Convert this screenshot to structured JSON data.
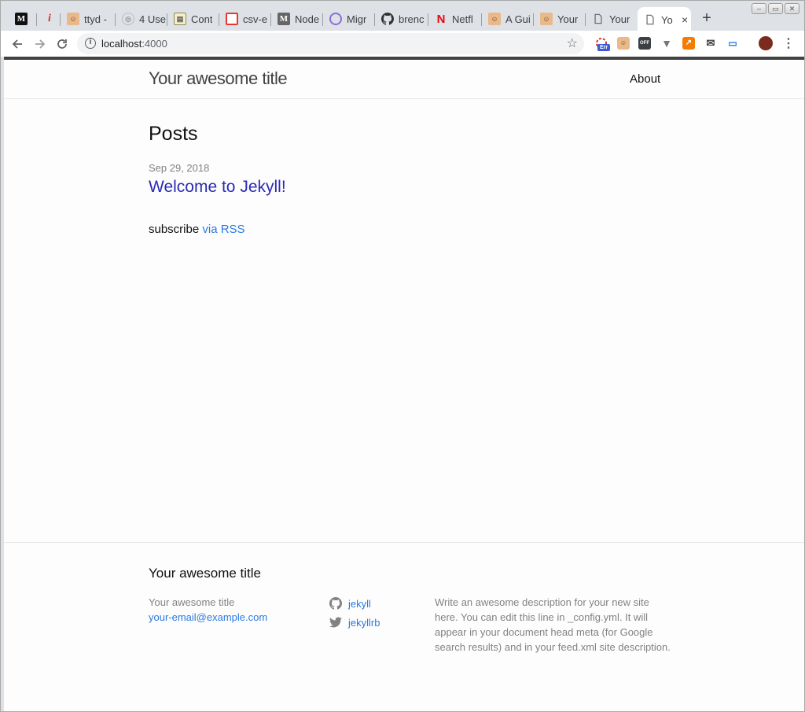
{
  "browser": {
    "tabs": [
      {
        "title": "",
        "icon": "medium-icon"
      },
      {
        "title": "",
        "icon": "red-i-icon"
      },
      {
        "title": "ttyd -",
        "icon": "face-icon"
      },
      {
        "title": "4 Use",
        "icon": "globe-icon"
      },
      {
        "title": "Cont",
        "icon": "doc-icon"
      },
      {
        "title": "csv-e",
        "icon": "red-box-icon"
      },
      {
        "title": "Node",
        "icon": "medium-icon"
      },
      {
        "title": "Migr",
        "icon": "purple-circle-icon"
      },
      {
        "title": "brenc",
        "icon": "github-icon"
      },
      {
        "title": "Netfl",
        "icon": "netflix-icon"
      },
      {
        "title": "A Gui",
        "icon": "face-icon"
      },
      {
        "title": "Your",
        "icon": "face-icon"
      },
      {
        "title": "Your",
        "icon": "page-icon"
      },
      {
        "title": "Yo",
        "icon": "page-icon",
        "active": true
      }
    ],
    "new_tab": "+",
    "close": "×",
    "url_host": "localhost",
    "url_port": ":4000",
    "ext_err_label": "Err",
    "ext_off_label": "OFF"
  },
  "header": {
    "site_title": "Your awesome title",
    "nav_about": "About"
  },
  "main": {
    "heading": "Posts",
    "posts": [
      {
        "date": "Sep 29, 2018",
        "title": "Welcome to Jekyll!"
      }
    ],
    "rss_prefix": "subscribe",
    "rss_link": "via RSS"
  },
  "footer": {
    "heading": "Your awesome title",
    "name": "Your awesome title",
    "email": "your-email@example.com",
    "github": "jekyll",
    "twitter": "jekyllrb",
    "description": "Write an awesome description for your new site here. You can edit this line in _config.yml. It will appear in your document head meta (for Google search results) and in your feed.xml site description."
  },
  "colors": {
    "link": "#2a7ae2",
    "post_link": "#2a2ab5",
    "meta": "#828282",
    "page_bg": "#fdfdfd"
  }
}
